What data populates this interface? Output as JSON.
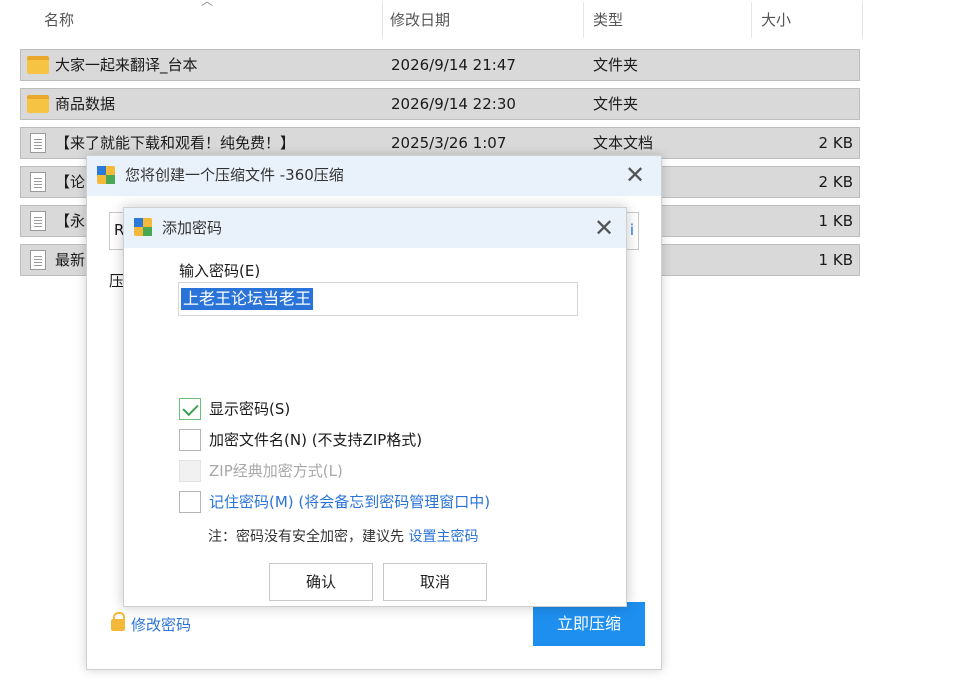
{
  "explorer": {
    "columns": {
      "name": "名称",
      "date": "修改日期",
      "type": "类型",
      "size": "大小"
    },
    "files": [
      {
        "name": "大家一起来翻译_台本",
        "date": "2026/9/14 21:47",
        "type": "文件夹",
        "size": "",
        "icon": "folder-icon"
      },
      {
        "name": "商品数据",
        "date": "2026/9/14 22:30",
        "type": "文件夹",
        "size": "",
        "icon": "folder-icon"
      },
      {
        "name": "【来了就能下载和观看！纯免费！】",
        "date": "2025/3/26 1:07",
        "type": "文本文档",
        "size": "2 KB",
        "icon": "document-icon"
      },
      {
        "name": "【论",
        "date": "",
        "type": "",
        "size": "2 KB",
        "icon": "document-icon"
      },
      {
        "name": "【永",
        "date": "",
        "type": "",
        "size": "1 KB",
        "icon": "document-icon"
      },
      {
        "name": "最新",
        "date": "",
        "type": "",
        "size": "1 KB",
        "icon": "document-icon"
      }
    ]
  },
  "compress_dialog": {
    "title": "您将创建一个压缩文件 -360压缩",
    "close": "✕",
    "field_fragment_left": "R",
    "field_fragment_right": "i",
    "label_fragment": "压",
    "modify_password": "修改密码",
    "compress_now": "立即压缩"
  },
  "password_dialog": {
    "title": "添加密码",
    "close": "✕",
    "input_label": "输入密码(E)",
    "password_value": "上老王论坛当老王",
    "options": {
      "show_password": {
        "label": "显示密码(S)",
        "checked": true
      },
      "encrypt_filenames": {
        "label": "加密文件名(N) (不支持ZIP格式)",
        "checked": false
      },
      "zip_classic": {
        "label": "ZIP经典加密方式(L)",
        "checked": false,
        "disabled": true
      },
      "remember_password": {
        "label": "记住密码(M) (将会备忘到密码管理窗口中)",
        "checked": false
      }
    },
    "note_prefix": "注：密码没有安全加密，建议先 ",
    "note_link": "设置主密码",
    "ok": "确认",
    "cancel": "取消"
  }
}
